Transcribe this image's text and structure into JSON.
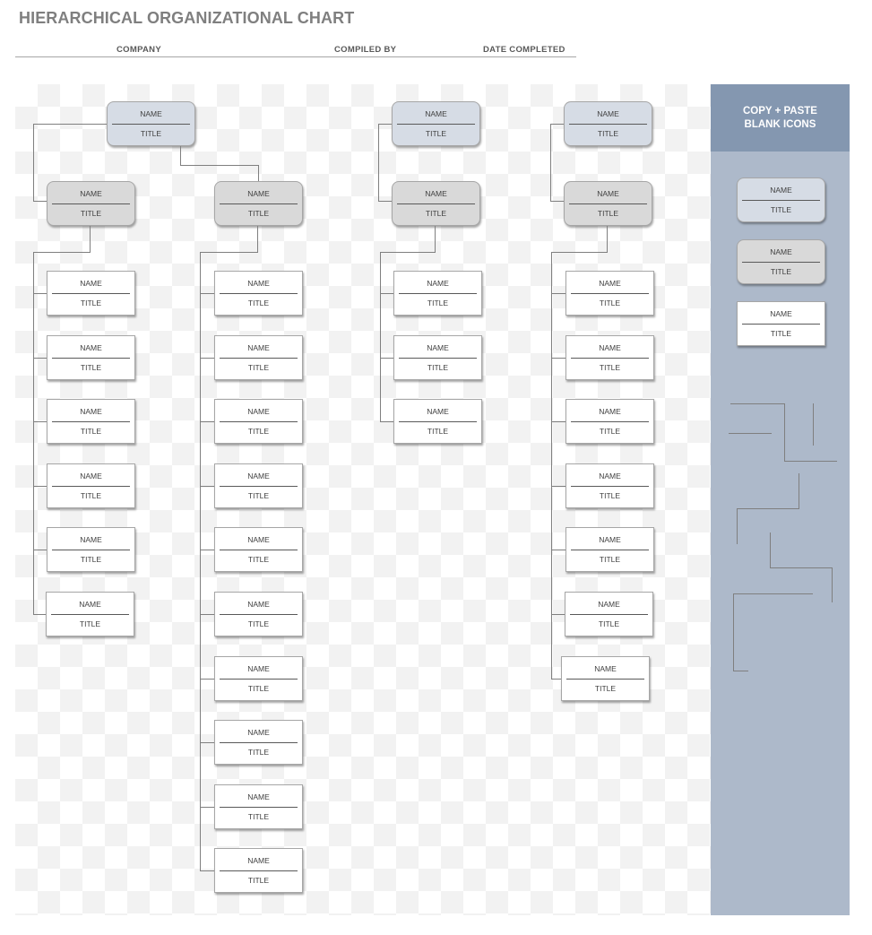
{
  "header": {
    "title": "HIERARCHICAL ORGANIZATIONAL CHART",
    "fields": [
      {
        "label": "COMPANY"
      },
      {
        "label": "COMPILED BY"
      },
      {
        "label": "DATE COMPLETED"
      }
    ]
  },
  "node_text": {
    "name": "NAME",
    "title": "TITLE"
  },
  "chart": {
    "columns": [
      {
        "top": {
          "style": "blue",
          "name": "NAME",
          "title": "TITLE"
        },
        "managers": [
          {
            "style": "gray",
            "name": "NAME",
            "title": "TITLE",
            "reports": 6
          },
          {
            "style": "gray",
            "name": "NAME",
            "title": "TITLE",
            "reports": 10
          }
        ]
      },
      {
        "top": {
          "style": "blue",
          "name": "NAME",
          "title": "TITLE"
        },
        "managers": [
          {
            "style": "gray",
            "name": "NAME",
            "title": "TITLE",
            "reports": 3
          }
        ]
      },
      {
        "top": {
          "style": "blue",
          "name": "NAME",
          "title": "TITLE"
        },
        "managers": [
          {
            "style": "gray",
            "name": "NAME",
            "title": "TITLE",
            "reports": 7
          }
        ]
      }
    ]
  },
  "sidebar": {
    "heading_line1": "COPY + PASTE",
    "heading_line2": "BLANK ICONS",
    "templates": [
      {
        "style": "blue",
        "name": "NAME",
        "title": "TITLE"
      },
      {
        "style": "gray",
        "name": "NAME",
        "title": "TITLE"
      },
      {
        "style": "white",
        "name": "NAME",
        "title": "TITLE"
      }
    ],
    "connector_pieces": 7
  },
  "colors": {
    "title": "#7f7f7f",
    "node_blue": "#d6dce5",
    "node_gray": "#d9d9d9",
    "node_white": "#ffffff",
    "sidebar": "#adb9ca",
    "sidebar_header": "#8497b0",
    "connector": "#7f7f7f"
  }
}
